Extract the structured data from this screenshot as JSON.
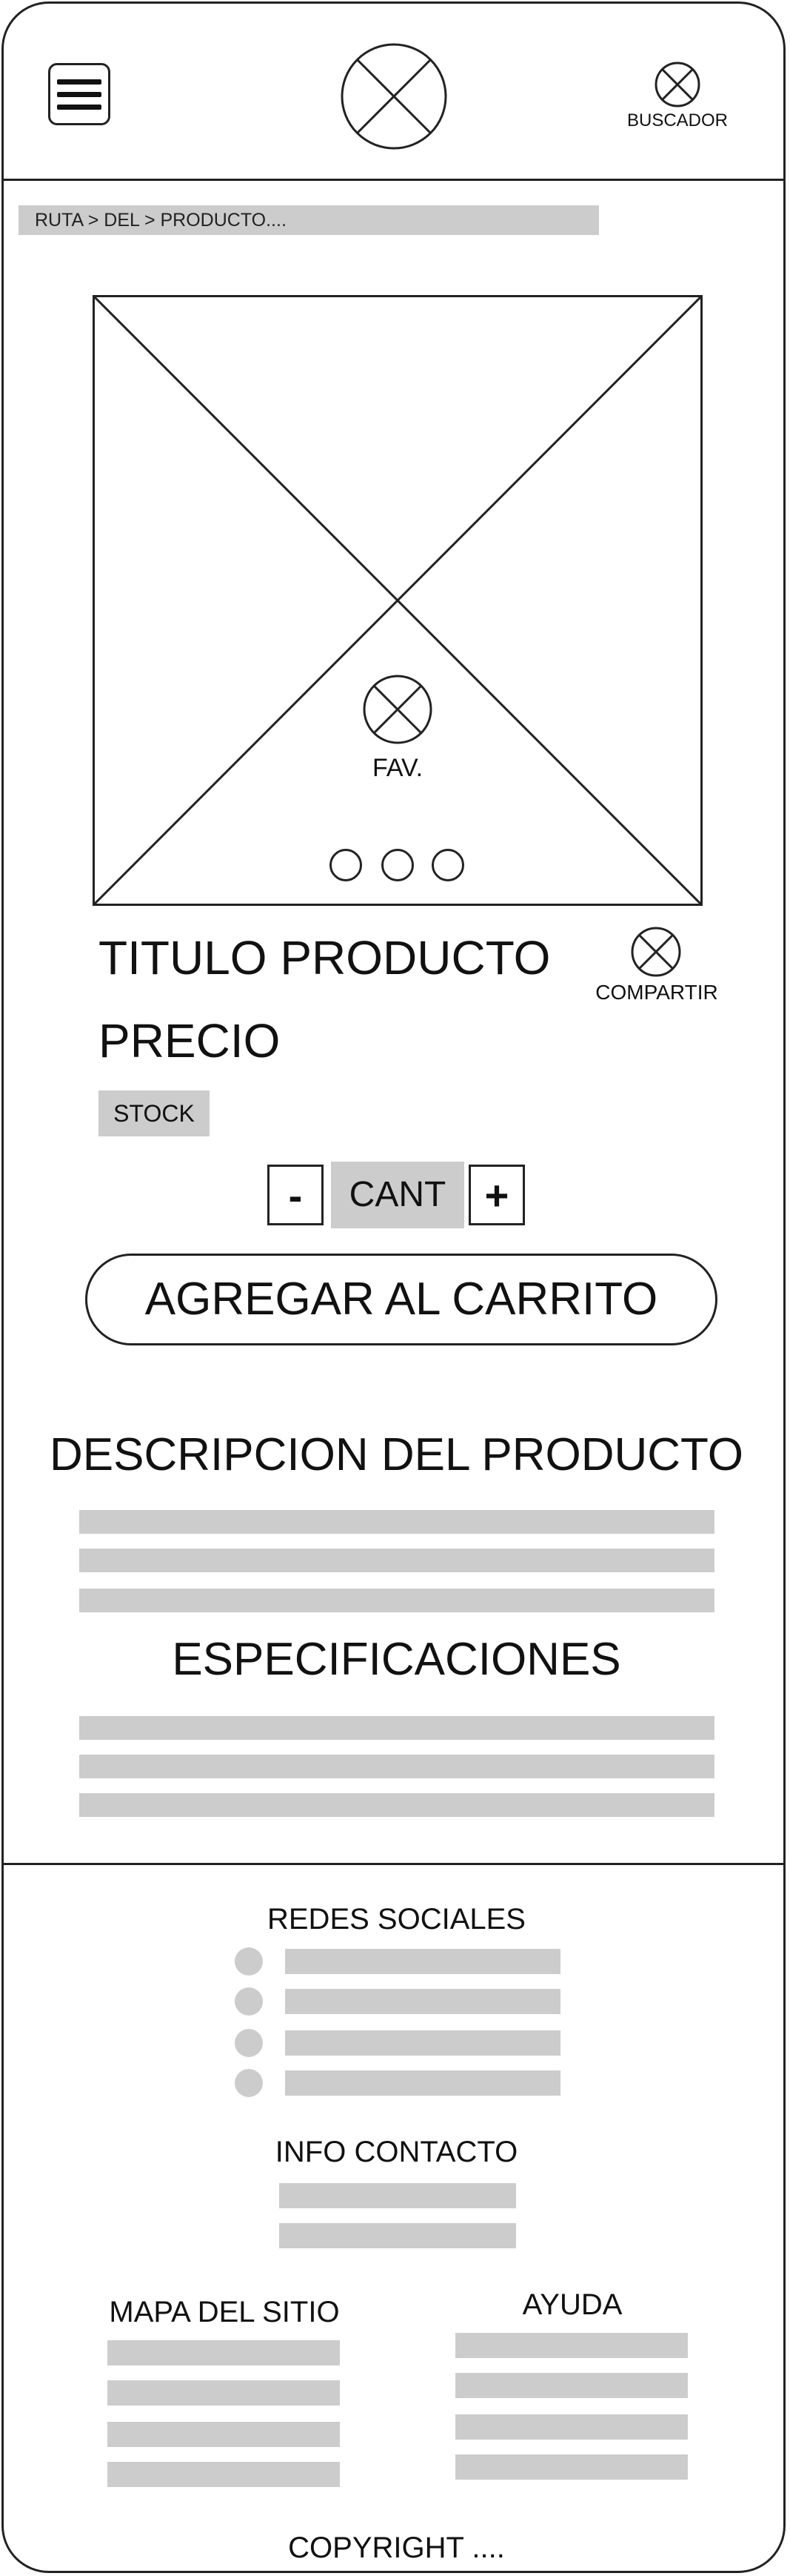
{
  "header": {
    "search_label": "BUSCADOR"
  },
  "breadcrumb": "RUTA > DEL > PRODUCTO....",
  "product": {
    "fav_label": "FAV.",
    "title": "TITULO PRODUCTO",
    "share_label": "COMPARTIR",
    "price": "PRECIO",
    "stock": "STOCK",
    "qty_minus": "-",
    "qty_value": "CANT",
    "qty_plus": "+",
    "add_to_cart": "AGREGAR AL CARRITO"
  },
  "description": {
    "heading": "DESCRIPCION DEL PRODUCTO"
  },
  "specs": {
    "heading": "ESPECIFICACIONES"
  },
  "footer": {
    "social_heading": "REDES SOCIALES",
    "contact_heading": "INFO CONTACTO",
    "sitemap_heading": "MAPA DEL SITIO",
    "help_heading": "AYUDA",
    "copyright": "COPYRIGHT ...."
  },
  "colors": {
    "stroke": "#222222",
    "placeholder_grey": "#cccccc"
  },
  "icons": [
    "hamburger-menu-icon",
    "logo-placeholder-icon",
    "search-icon",
    "favorite-icon",
    "share-icon",
    "social-icon"
  ]
}
